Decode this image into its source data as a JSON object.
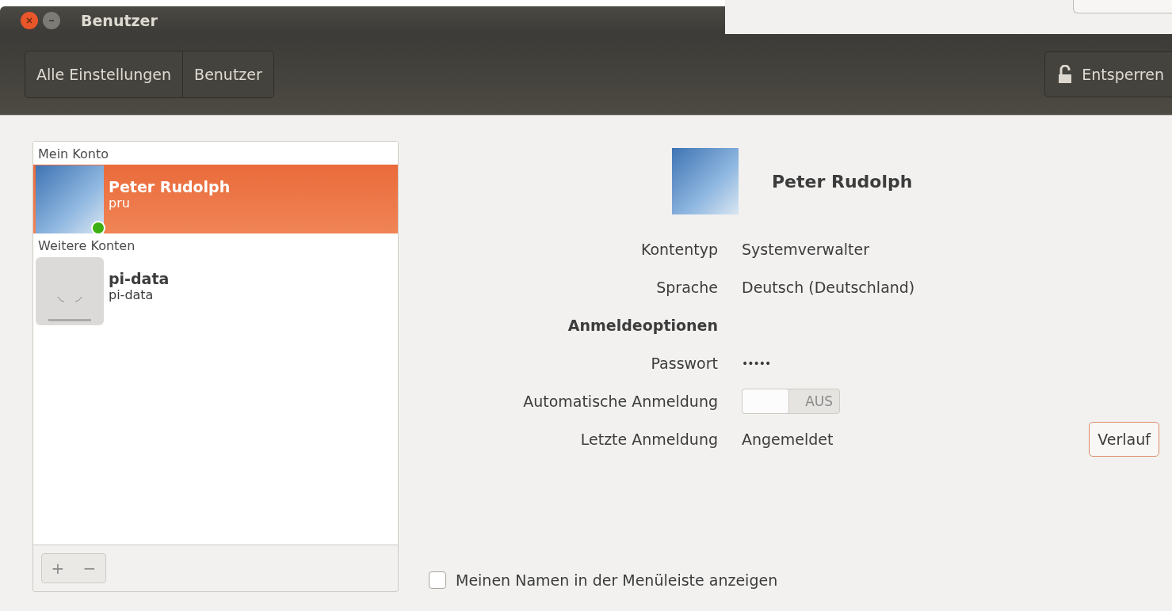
{
  "window": {
    "title": "Benutzer"
  },
  "toolbar": {
    "breadcrumbs": [
      {
        "label": "Alle Einstellungen"
      },
      {
        "label": "Benutzer"
      }
    ],
    "unlock_button": "Entsperren"
  },
  "accounts": [
    {
      "heading": "Mein Konto",
      "users": [
        {
          "name": "Peter Rudolph",
          "login": "pru",
          "selected": true,
          "online": true,
          "kind": "photo"
        }
      ]
    },
    {
      "heading": "Weitere Konten",
      "users": [
        {
          "name": "pi-data",
          "login": "pi-data",
          "selected": false,
          "online": false,
          "kind": "default"
        }
      ]
    }
  ],
  "list_buttons": [
    "+",
    "−"
  ],
  "details": {
    "name": "Peter Rudolph",
    "fields": [
      {
        "kind": "text",
        "label": "Kontentyp",
        "value": "Systemverwalter"
      },
      {
        "kind": "text",
        "label": "Sprache",
        "value": "Deutsch (Deutschland)"
      },
      {
        "kind": "heading",
        "label": "Anmeldeoptionen"
      },
      {
        "kind": "password",
        "label": "Passwort",
        "value": "•••••"
      },
      {
        "kind": "switch",
        "label": "Automatische Anmeldung",
        "on": false,
        "state_label": "AUS"
      },
      {
        "kind": "text_button",
        "label": "Letzte Anmeldung",
        "value": "Angemeldet",
        "button": "Verlauf"
      }
    ]
  },
  "menu_checkbox": {
    "label": "Meinen Namen in der Menüleiste anzeigen",
    "checked": false
  }
}
